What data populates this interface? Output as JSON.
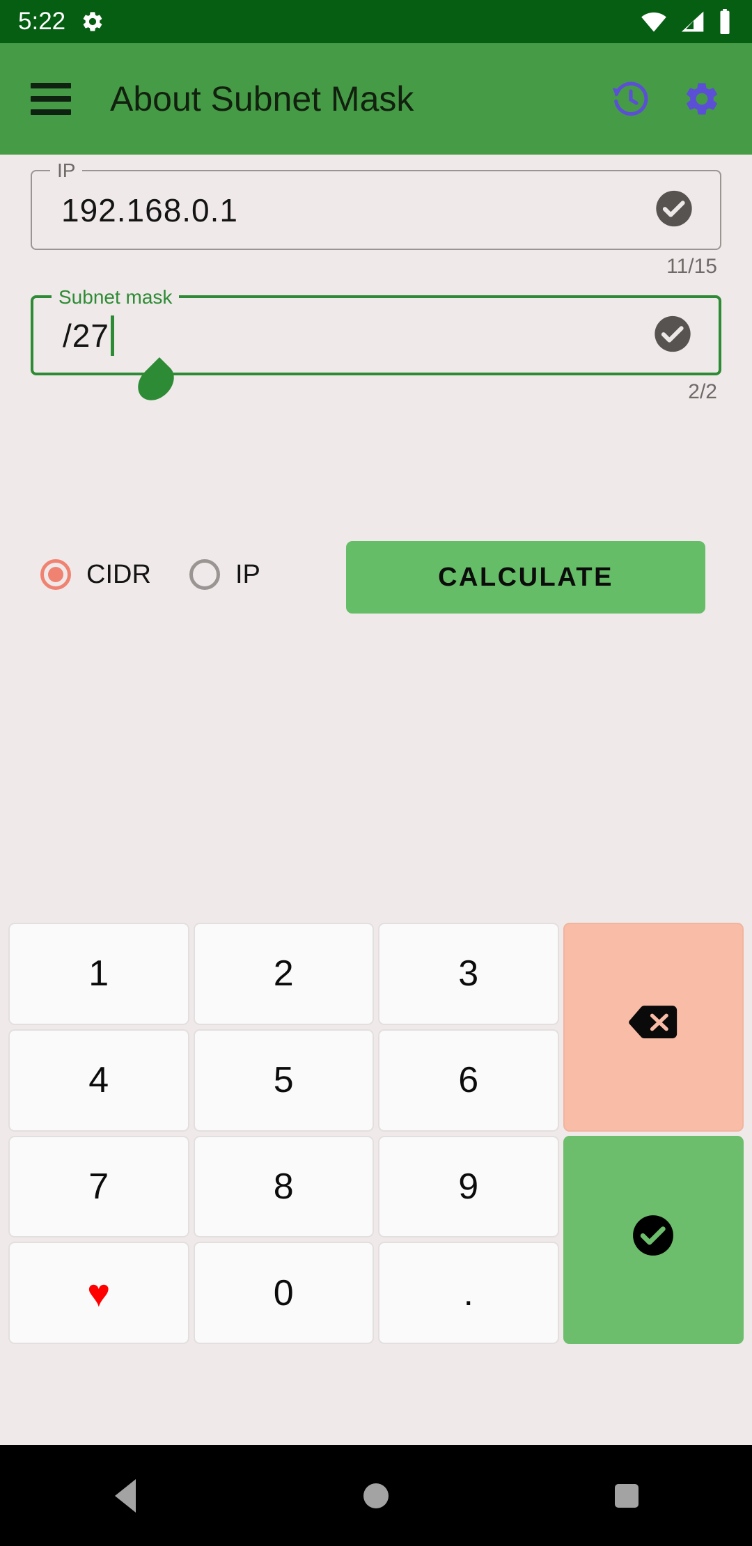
{
  "status_bar": {
    "time": "5:22",
    "icons": [
      "gear-icon",
      "wifi-icon",
      "cell-signal-icon",
      "battery-icon"
    ],
    "background_color": "#065E12"
  },
  "app_bar": {
    "menu_icon": "hamburger-menu-icon",
    "title": "About Subnet Mask",
    "actions": [
      {
        "name": "history-icon",
        "color": "#5B4FD6"
      },
      {
        "name": "settings-gear-icon",
        "color": "#5B4FD6"
      }
    ],
    "background_color": "#469B46"
  },
  "form": {
    "ip_field": {
      "label": "IP",
      "value": "192.168.0.1",
      "counter": "11/15",
      "trailing_icon": "check-circle-icon",
      "focused": false
    },
    "subnet_field": {
      "label": "Subnet mask",
      "value": "/27",
      "counter": "2/2",
      "trailing_icon": "check-circle-icon",
      "focused": true,
      "accent_color": "#2E8B35"
    },
    "mode_options": [
      {
        "label": "CIDR",
        "selected": true
      },
      {
        "label": "IP",
        "selected": false
      }
    ],
    "selected_radio_color": "#F08272",
    "calculate_button": {
      "label": "CALCULATE",
      "color": "#66BD67"
    }
  },
  "keypad": {
    "keys": [
      {
        "label": "1",
        "type": "digit"
      },
      {
        "label": "2",
        "type": "digit"
      },
      {
        "label": "3",
        "type": "digit"
      },
      {
        "label": "4",
        "type": "digit"
      },
      {
        "label": "5",
        "type": "digit"
      },
      {
        "label": "6",
        "type": "digit"
      },
      {
        "label": "7",
        "type": "digit"
      },
      {
        "label": "8",
        "type": "digit"
      },
      {
        "label": "9",
        "type": "digit"
      },
      {
        "label": "♥",
        "type": "heart"
      },
      {
        "label": "0",
        "type": "digit"
      },
      {
        "label": ".",
        "type": "dot"
      }
    ],
    "delete_key": {
      "icon": "backspace-icon",
      "color": "#F9BCA7"
    },
    "enter_key": {
      "icon": "check-circle-icon",
      "color": "#6CBE6C"
    }
  },
  "nav_bar": {
    "buttons": [
      "back-icon",
      "home-icon",
      "recents-icon"
    ],
    "color": "#A3A3A3"
  }
}
